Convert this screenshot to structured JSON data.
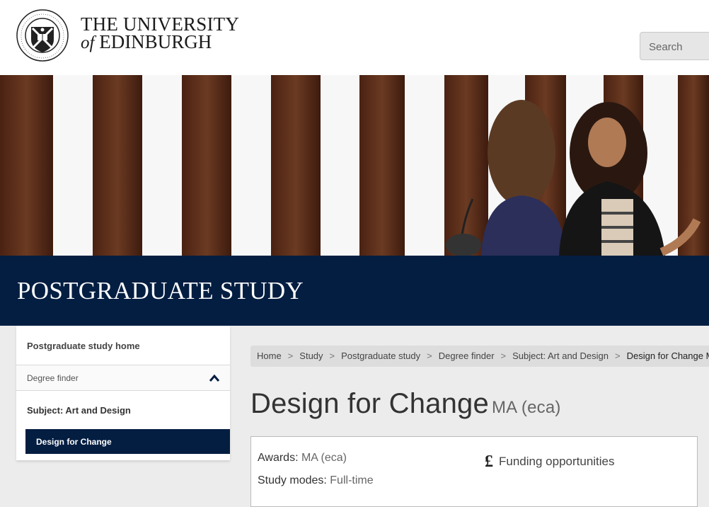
{
  "header": {
    "logo": {
      "crest_text": "THE UNIVERSITY OF EDINBURGH"
    },
    "name_line1": "THE UNIVERSITY",
    "name_of": "of",
    "name_line2": "EDINBURGH",
    "search_placeholder": "Search"
  },
  "banner": {
    "title": "POSTGRADUATE STUDY"
  },
  "sidebar": {
    "home": "Postgraduate study home",
    "finder": "Degree finder",
    "subject": "Subject: Art and Design",
    "current": "Design for Change"
  },
  "breadcrumb": {
    "items": [
      "Home",
      "Study",
      "Postgraduate study",
      "Degree finder",
      "Subject: Art and Design"
    ],
    "current": "Design for Change MA (eca)",
    "separator": ">"
  },
  "page": {
    "title": "Design for Change",
    "award": "MA (eca)"
  },
  "info": {
    "awards_label": "Awards:",
    "awards_value": "MA (eca)",
    "modes_label": "Study modes:",
    "modes_value": "Full-time",
    "funding_icon": "£",
    "funding": "Funding opportunities"
  },
  "colors": {
    "navy": "#041e42",
    "breadcrumb_bg": "#dddddd",
    "page_bg": "#ececec"
  }
}
